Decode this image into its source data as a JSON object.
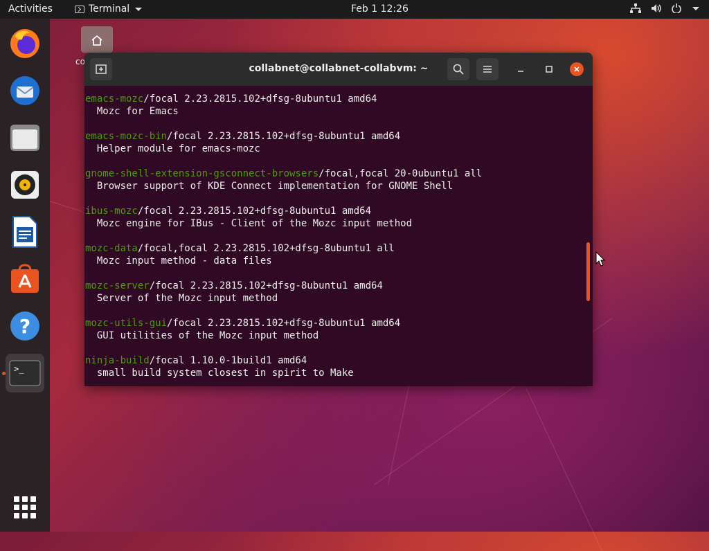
{
  "topbar": {
    "activities": "Activities",
    "app_name": "Terminal",
    "clock": "Feb 1  12:26"
  },
  "desktop": {
    "home_label": "co"
  },
  "dock": {
    "items": [
      "firefox-icon",
      "thunderbird-icon",
      "files-icon",
      "rhythmbox-icon",
      "libreoffice-writer-icon",
      "software-icon",
      "help-icon",
      "terminal-icon"
    ]
  },
  "terminal": {
    "title": "collabnet@collabnet-collabvm: ~",
    "entries": [
      {
        "pkg": "emacs-mozc",
        "rest": "/focal 2.23.2815.102+dfsg-8ubuntu1 amd64",
        "desc": "  Mozc for Emacs"
      },
      {
        "pkg": "emacs-mozc-bin",
        "rest": "/focal 2.23.2815.102+dfsg-8ubuntu1 amd64",
        "desc": "  Helper module for emacs-mozc"
      },
      {
        "pkg": "gnome-shell-extension-gsconnect-browsers",
        "rest": "/focal,focal 20-0ubuntu1 all",
        "desc": "  Browser support of KDE Connect implementation for GNOME Shell"
      },
      {
        "pkg": "ibus-mozc",
        "rest": "/focal 2.23.2815.102+dfsg-8ubuntu1 amd64",
        "desc": "  Mozc engine for IBus - Client of the Mozc input method"
      },
      {
        "pkg": "mozc-data",
        "rest": "/focal,focal 2.23.2815.102+dfsg-8ubuntu1 all",
        "desc": "  Mozc input method - data files"
      },
      {
        "pkg": "mozc-server",
        "rest": "/focal 2.23.2815.102+dfsg-8ubuntu1 amd64",
        "desc": "  Server of the Mozc input method"
      },
      {
        "pkg": "mozc-utils-gui",
        "rest": "/focal 2.23.2815.102+dfsg-8ubuntu1 amd64",
        "desc": "  GUI utilities of the Mozc input method"
      },
      {
        "pkg": "ninja-build",
        "rest": "/focal 1.10.0-1build1 amd64",
        "desc": "  small build system closest in spirit to Make"
      }
    ]
  },
  "colors": {
    "accent": "#e95420",
    "terminal_bg": "#300a24",
    "package_green": "#4e9a06"
  }
}
